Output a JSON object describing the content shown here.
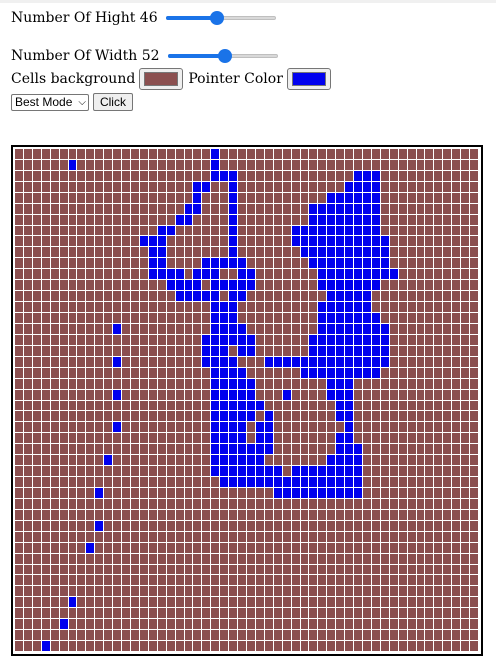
{
  "controls": {
    "height_label": "Number Of Hight 46",
    "height_value": 46,
    "height_fraction": 0.47,
    "width_label": "Number Of Width 52",
    "width_value": 52,
    "width_fraction": 0.52,
    "cells_background_label": "Cells background",
    "cells_background_color": "#8b4f4f",
    "pointer_color_label": "Pointer Color",
    "pointer_color": "#0000ee",
    "mode_selected": "Best Mode",
    "click_button_label": "Click"
  },
  "grid": {
    "rows": 46,
    "cols": 52,
    "cell_color": "#8b4f4f",
    "line_color": "#ffffff",
    "painted_cells": [
      [
        0,
        22
      ],
      [
        1,
        6
      ],
      [
        1,
        22
      ],
      [
        2,
        22
      ],
      [
        2,
        23
      ],
      [
        2,
        24
      ],
      [
        2,
        38
      ],
      [
        2,
        39
      ],
      [
        2,
        40
      ],
      [
        3,
        20
      ],
      [
        3,
        21
      ],
      [
        3,
        24
      ],
      [
        3,
        37
      ],
      [
        3,
        38
      ],
      [
        3,
        39
      ],
      [
        3,
        40
      ],
      [
        4,
        20
      ],
      [
        4,
        24
      ],
      [
        4,
        35
      ],
      [
        4,
        36
      ],
      [
        4,
        37
      ],
      [
        4,
        38
      ],
      [
        4,
        39
      ],
      [
        4,
        40
      ],
      [
        5,
        19
      ],
      [
        5,
        20
      ],
      [
        5,
        24
      ],
      [
        5,
        33
      ],
      [
        5,
        34
      ],
      [
        5,
        35
      ],
      [
        5,
        36
      ],
      [
        5,
        37
      ],
      [
        5,
        38
      ],
      [
        5,
        39
      ],
      [
        5,
        40
      ],
      [
        6,
        18
      ],
      [
        6,
        19
      ],
      [
        6,
        24
      ],
      [
        6,
        33
      ],
      [
        6,
        34
      ],
      [
        6,
        35
      ],
      [
        6,
        36
      ],
      [
        6,
        37
      ],
      [
        6,
        38
      ],
      [
        6,
        39
      ],
      [
        6,
        40
      ],
      [
        7,
        16
      ],
      [
        7,
        17
      ],
      [
        7,
        24
      ],
      [
        7,
        31
      ],
      [
        7,
        32
      ],
      [
        7,
        33
      ],
      [
        7,
        34
      ],
      [
        7,
        35
      ],
      [
        7,
        36
      ],
      [
        7,
        37
      ],
      [
        7,
        38
      ],
      [
        7,
        39
      ],
      [
        7,
        40
      ],
      [
        8,
        14
      ],
      [
        8,
        15
      ],
      [
        8,
        16
      ],
      [
        8,
        24
      ],
      [
        8,
        31
      ],
      [
        8,
        32
      ],
      [
        8,
        33
      ],
      [
        8,
        34
      ],
      [
        8,
        35
      ],
      [
        8,
        36
      ],
      [
        8,
        37
      ],
      [
        8,
        38
      ],
      [
        8,
        39
      ],
      [
        8,
        40
      ],
      [
        8,
        41
      ],
      [
        9,
        15
      ],
      [
        9,
        16
      ],
      [
        9,
        24
      ],
      [
        9,
        32
      ],
      [
        9,
        33
      ],
      [
        9,
        34
      ],
      [
        9,
        35
      ],
      [
        9,
        36
      ],
      [
        9,
        37
      ],
      [
        9,
        38
      ],
      [
        9,
        39
      ],
      [
        9,
        40
      ],
      [
        9,
        41
      ],
      [
        10,
        15
      ],
      [
        10,
        16
      ],
      [
        10,
        21
      ],
      [
        10,
        22
      ],
      [
        10,
        23
      ],
      [
        10,
        24
      ],
      [
        10,
        25
      ],
      [
        10,
        33
      ],
      [
        10,
        34
      ],
      [
        10,
        35
      ],
      [
        10,
        36
      ],
      [
        10,
        37
      ],
      [
        10,
        38
      ],
      [
        10,
        39
      ],
      [
        10,
        40
      ],
      [
        10,
        41
      ],
      [
        11,
        15
      ],
      [
        11,
        16
      ],
      [
        11,
        17
      ],
      [
        11,
        18
      ],
      [
        11,
        20
      ],
      [
        11,
        21
      ],
      [
        11,
        22
      ],
      [
        11,
        25
      ],
      [
        11,
        26
      ],
      [
        11,
        34
      ],
      [
        11,
        35
      ],
      [
        11,
        36
      ],
      [
        11,
        37
      ],
      [
        11,
        38
      ],
      [
        11,
        39
      ],
      [
        11,
        40
      ],
      [
        11,
        41
      ],
      [
        11,
        42
      ],
      [
        12,
        17
      ],
      [
        12,
        18
      ],
      [
        12,
        19
      ],
      [
        12,
        20
      ],
      [
        12,
        22
      ],
      [
        12,
        23
      ],
      [
        12,
        24
      ],
      [
        12,
        25
      ],
      [
        12,
        26
      ],
      [
        12,
        34
      ],
      [
        12,
        35
      ],
      [
        12,
        36
      ],
      [
        12,
        37
      ],
      [
        12,
        38
      ],
      [
        12,
        39
      ],
      [
        12,
        40
      ],
      [
        13,
        18
      ],
      [
        13,
        19
      ],
      [
        13,
        20
      ],
      [
        13,
        21
      ],
      [
        13,
        22
      ],
      [
        13,
        24
      ],
      [
        13,
        25
      ],
      [
        13,
        35
      ],
      [
        13,
        36
      ],
      [
        13,
        37
      ],
      [
        13,
        38
      ],
      [
        13,
        39
      ],
      [
        14,
        22
      ],
      [
        14,
        23
      ],
      [
        14,
        24
      ],
      [
        14,
        34
      ],
      [
        14,
        35
      ],
      [
        14,
        36
      ],
      [
        14,
        37
      ],
      [
        14,
        38
      ],
      [
        14,
        39
      ],
      [
        15,
        22
      ],
      [
        15,
        23
      ],
      [
        15,
        24
      ],
      [
        15,
        34
      ],
      [
        15,
        35
      ],
      [
        15,
        36
      ],
      [
        15,
        37
      ],
      [
        15,
        38
      ],
      [
        15,
        39
      ],
      [
        15,
        40
      ],
      [
        16,
        11
      ],
      [
        16,
        22
      ],
      [
        16,
        23
      ],
      [
        16,
        24
      ],
      [
        16,
        25
      ],
      [
        16,
        34
      ],
      [
        16,
        35
      ],
      [
        16,
        36
      ],
      [
        16,
        37
      ],
      [
        16,
        38
      ],
      [
        16,
        39
      ],
      [
        16,
        40
      ],
      [
        16,
        41
      ],
      [
        17,
        21
      ],
      [
        17,
        22
      ],
      [
        17,
        23
      ],
      [
        17,
        24
      ],
      [
        17,
        25
      ],
      [
        17,
        26
      ],
      [
        17,
        33
      ],
      [
        17,
        34
      ],
      [
        17,
        35
      ],
      [
        17,
        36
      ],
      [
        17,
        37
      ],
      [
        17,
        38
      ],
      [
        17,
        39
      ],
      [
        17,
        40
      ],
      [
        17,
        41
      ],
      [
        18,
        21
      ],
      [
        18,
        22
      ],
      [
        18,
        23
      ],
      [
        18,
        25
      ],
      [
        18,
        26
      ],
      [
        18,
        33
      ],
      [
        18,
        34
      ],
      [
        18,
        35
      ],
      [
        18,
        36
      ],
      [
        18,
        37
      ],
      [
        18,
        38
      ],
      [
        18,
        39
      ],
      [
        18,
        40
      ],
      [
        18,
        41
      ],
      [
        19,
        11
      ],
      [
        19,
        21
      ],
      [
        19,
        22
      ],
      [
        19,
        23
      ],
      [
        19,
        24
      ],
      [
        19,
        28
      ],
      [
        19,
        29
      ],
      [
        19,
        30
      ],
      [
        19,
        31
      ],
      [
        19,
        32
      ],
      [
        19,
        33
      ],
      [
        19,
        34
      ],
      [
        19,
        35
      ],
      [
        19,
        36
      ],
      [
        19,
        37
      ],
      [
        19,
        38
      ],
      [
        19,
        39
      ],
      [
        19,
        40
      ],
      [
        19,
        41
      ],
      [
        20,
        22
      ],
      [
        20,
        23
      ],
      [
        20,
        24
      ],
      [
        20,
        25
      ],
      [
        20,
        32
      ],
      [
        20,
        33
      ],
      [
        20,
        34
      ],
      [
        20,
        35
      ],
      [
        20,
        36
      ],
      [
        20,
        37
      ],
      [
        20,
        38
      ],
      [
        20,
        39
      ],
      [
        20,
        40
      ],
      [
        21,
        22
      ],
      [
        21,
        23
      ],
      [
        21,
        24
      ],
      [
        21,
        25
      ],
      [
        21,
        26
      ],
      [
        21,
        35
      ],
      [
        21,
        36
      ],
      [
        21,
        37
      ],
      [
        22,
        11
      ],
      [
        22,
        22
      ],
      [
        22,
        23
      ],
      [
        22,
        24
      ],
      [
        22,
        25
      ],
      [
        22,
        26
      ],
      [
        22,
        30
      ],
      [
        22,
        35
      ],
      [
        22,
        36
      ],
      [
        22,
        37
      ],
      [
        23,
        22
      ],
      [
        23,
        23
      ],
      [
        23,
        24
      ],
      [
        23,
        25
      ],
      [
        23,
        26
      ],
      [
        23,
        27
      ],
      [
        23,
        36
      ],
      [
        23,
        37
      ],
      [
        24,
        22
      ],
      [
        24,
        23
      ],
      [
        24,
        24
      ],
      [
        24,
        25
      ],
      [
        24,
        26
      ],
      [
        24,
        28
      ],
      [
        24,
        36
      ],
      [
        24,
        37
      ],
      [
        25,
        11
      ],
      [
        25,
        22
      ],
      [
        25,
        23
      ],
      [
        25,
        24
      ],
      [
        25,
        25
      ],
      [
        25,
        27
      ],
      [
        25,
        28
      ],
      [
        25,
        37
      ],
      [
        26,
        22
      ],
      [
        26,
        23
      ],
      [
        26,
        24
      ],
      [
        26,
        25
      ],
      [
        26,
        27
      ],
      [
        26,
        28
      ],
      [
        26,
        36
      ],
      [
        26,
        37
      ],
      [
        27,
        22
      ],
      [
        27,
        23
      ],
      [
        27,
        24
      ],
      [
        27,
        25
      ],
      [
        27,
        26
      ],
      [
        27,
        27
      ],
      [
        27,
        28
      ],
      [
        27,
        36
      ],
      [
        27,
        37
      ],
      [
        27,
        38
      ],
      [
        28,
        10
      ],
      [
        28,
        22
      ],
      [
        28,
        23
      ],
      [
        28,
        24
      ],
      [
        28,
        25
      ],
      [
        28,
        26
      ],
      [
        28,
        27
      ],
      [
        28,
        35
      ],
      [
        28,
        36
      ],
      [
        28,
        37
      ],
      [
        28,
        38
      ],
      [
        29,
        22
      ],
      [
        29,
        23
      ],
      [
        29,
        24
      ],
      [
        29,
        25
      ],
      [
        29,
        26
      ],
      [
        29,
        27
      ],
      [
        29,
        28
      ],
      [
        29,
        29
      ],
      [
        29,
        31
      ],
      [
        29,
        32
      ],
      [
        29,
        33
      ],
      [
        29,
        34
      ],
      [
        29,
        35
      ],
      [
        29,
        36
      ],
      [
        29,
        37
      ],
      [
        29,
        38
      ],
      [
        30,
        23
      ],
      [
        30,
        24
      ],
      [
        30,
        25
      ],
      [
        30,
        26
      ],
      [
        30,
        27
      ],
      [
        30,
        28
      ],
      [
        30,
        29
      ],
      [
        30,
        30
      ],
      [
        30,
        31
      ],
      [
        30,
        32
      ],
      [
        30,
        33
      ],
      [
        30,
        34
      ],
      [
        30,
        35
      ],
      [
        30,
        36
      ],
      [
        30,
        37
      ],
      [
        30,
        38
      ],
      [
        31,
        9
      ],
      [
        31,
        29
      ],
      [
        31,
        30
      ],
      [
        31,
        31
      ],
      [
        31,
        32
      ],
      [
        31,
        33
      ],
      [
        31,
        34
      ],
      [
        31,
        35
      ],
      [
        31,
        36
      ],
      [
        31,
        37
      ],
      [
        31,
        38
      ],
      [
        34,
        9
      ],
      [
        36,
        8
      ],
      [
        41,
        6
      ],
      [
        43,
        5
      ],
      [
        45,
        3
      ]
    ]
  }
}
